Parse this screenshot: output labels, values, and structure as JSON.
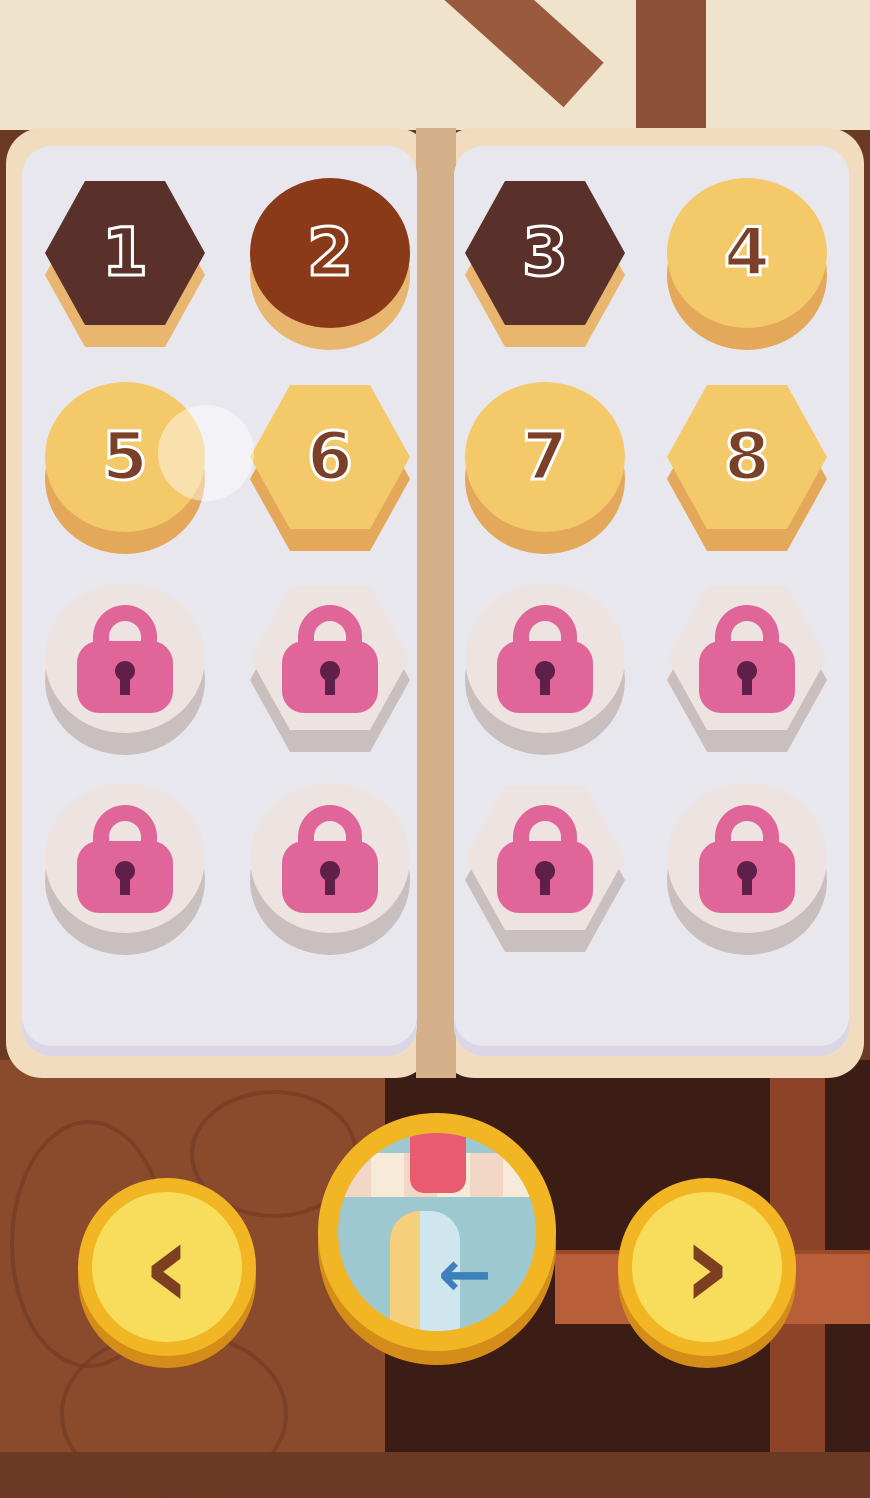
{
  "screen": "level-select",
  "colors": {
    "chocolate": "#5a302a",
    "caramel": "#8a3a18",
    "cookie": "#f4c96a",
    "lock_pink": "#e0669a",
    "button_gold": "#f2b624"
  },
  "levels": [
    {
      "label": "1",
      "shape": "hex",
      "style": "chocolate",
      "locked": false
    },
    {
      "label": "2",
      "shape": "round",
      "style": "caramel",
      "locked": false
    },
    {
      "label": "3",
      "shape": "hex",
      "style": "chocolate",
      "locked": false
    },
    {
      "label": "4",
      "shape": "round",
      "style": "cookie",
      "locked": false
    },
    {
      "label": "5",
      "shape": "round",
      "style": "cookie",
      "locked": false
    },
    {
      "label": "6",
      "shape": "hex",
      "style": "cookie",
      "locked": false
    },
    {
      "label": "7",
      "shape": "round",
      "style": "cookie",
      "locked": false
    },
    {
      "label": "8",
      "shape": "hex",
      "style": "cookie",
      "locked": false
    },
    {
      "label": "",
      "shape": "round",
      "style": "locked",
      "locked": true
    },
    {
      "label": "",
      "shape": "hex",
      "style": "locked",
      "locked": true
    },
    {
      "label": "",
      "shape": "round",
      "style": "locked",
      "locked": true
    },
    {
      "label": "",
      "shape": "hex",
      "style": "locked",
      "locked": true
    },
    {
      "label": "",
      "shape": "round",
      "style": "locked",
      "locked": true
    },
    {
      "label": "",
      "shape": "round",
      "style": "locked",
      "locked": true
    },
    {
      "label": "",
      "shape": "hex",
      "style": "locked",
      "locked": true
    },
    {
      "label": "",
      "shape": "round",
      "style": "locked",
      "locked": true
    }
  ],
  "nav": {
    "prev_icon": "chevron-left-icon",
    "prev_glyph": "‹",
    "shop_icon": "shop-exit-icon",
    "next_icon": "chevron-right-icon",
    "next_glyph": "›"
  }
}
